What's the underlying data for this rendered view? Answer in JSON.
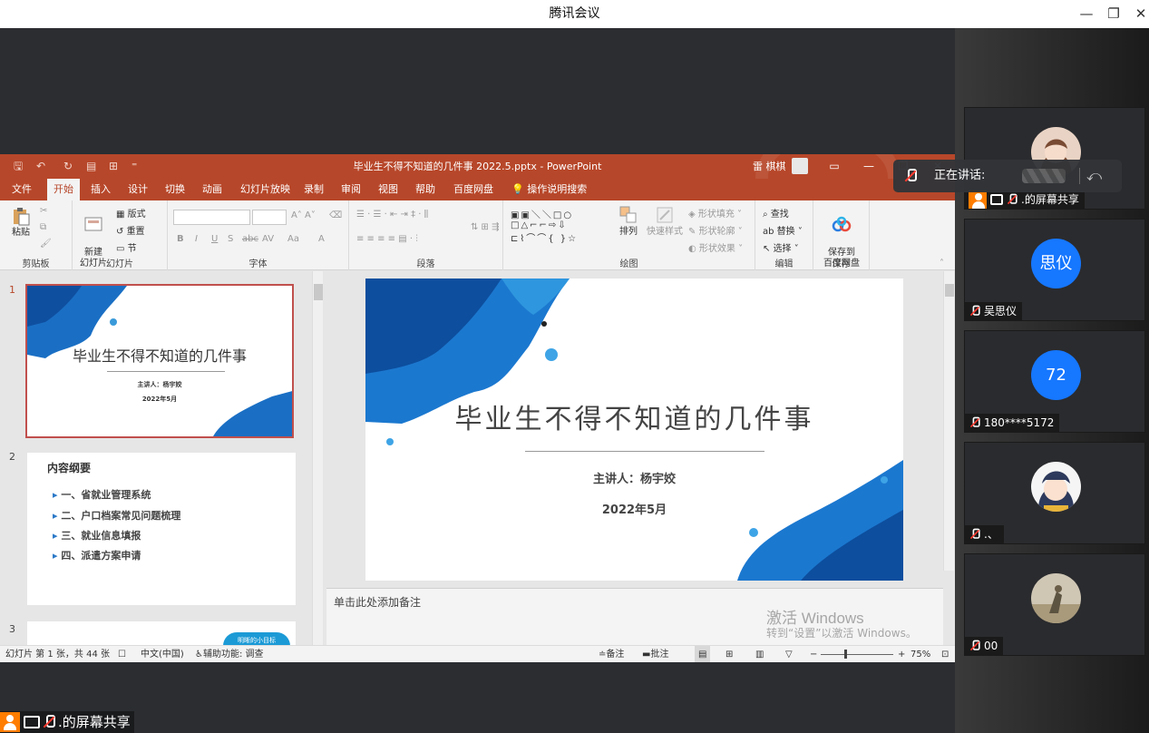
{
  "window": {
    "title": "腾讯会议",
    "controls": {
      "minimize": "—",
      "restore": "❐",
      "close": "✕"
    }
  },
  "ppt": {
    "doc_title": "毕业生不得不知道的几件事 2022.5.pptx  -  PowerPoint",
    "user": "雷 棋棋",
    "tabs": [
      "文件",
      "开始",
      "插入",
      "设计",
      "切换",
      "动画",
      "幻灯片放映",
      "录制",
      "审阅",
      "视图",
      "帮助",
      "百度网盘"
    ],
    "active_tab": "开始",
    "tell_me": "操作说明搜索",
    "ribbon": {
      "clipboard": {
        "label": "剪贴板",
        "paste": "粘贴"
      },
      "slides": {
        "label": "幻灯片",
        "new_slide": "新建\n幻灯片",
        "layout": "版式",
        "reset": "重置",
        "section": "节"
      },
      "font": {
        "label": "字体",
        "bold": "B",
        "italic": "I",
        "underline": "U",
        "shadow": "S",
        "strike": "abc",
        "spacing": "AV",
        "case": "Aa",
        "color": "A"
      },
      "paragraph": {
        "label": "段落"
      },
      "drawing": {
        "label": "绘图",
        "arrange": "排列",
        "quick_styles": "快速样式",
        "fill": "形状填充",
        "outline": "形状轮廓",
        "effects": "形状效果"
      },
      "editing": {
        "label": "编辑",
        "find": "查找",
        "replace": "替换",
        "select": "选择"
      },
      "save": {
        "label": "保存",
        "save_baidu": "保存到\n百度网盘"
      }
    },
    "thumbs": [
      {
        "num": "1",
        "title": "毕业生不得不知道的几件事",
        "speaker": "主讲人：杨宇姣",
        "date": "2022年5月"
      },
      {
        "num": "2",
        "heading": "内容纲要",
        "items": [
          "一、省就业管理系统",
          "二、户口档案常见问题梳理",
          "三、就业信息填报",
          "四、派遣方案申请"
        ]
      },
      {
        "num": "3",
        "badge": "明晰的小目标"
      }
    ],
    "slide": {
      "title": "毕业生不得不知道的几件事",
      "speaker": "主讲人：杨宇姣",
      "date": "2022年5月"
    },
    "notes_placeholder": "单击此处添加备注",
    "watermark": {
      "line1": "激活 Windows",
      "line2": "转到“设置”以激活 Windows。"
    },
    "status": {
      "slide_info": "幻灯片 第 1 张，共 44 张",
      "language": "中文(中国)",
      "accessibility": "辅助功能: 调查",
      "notes": "备注",
      "comments": "批注",
      "zoom": "75%"
    }
  },
  "share_label": ".的屏幕共享",
  "speaking": {
    "label": "正在讲话:"
  },
  "participants": [
    {
      "name": ".的屏幕共享",
      "type": "photo-girl"
    },
    {
      "name": "吴思仪",
      "type": "initials",
      "initials": "思仪"
    },
    {
      "name": "180****5172",
      "type": "initials",
      "initials": "72"
    },
    {
      "name": ".、",
      "type": "photo-cartoon"
    },
    {
      "name": "00",
      "type": "photo-outdoor"
    }
  ],
  "colors": {
    "ppt_accent": "#b7472a",
    "meeting_blue": "#1677ff",
    "share_orange": "#ff7d00"
  }
}
